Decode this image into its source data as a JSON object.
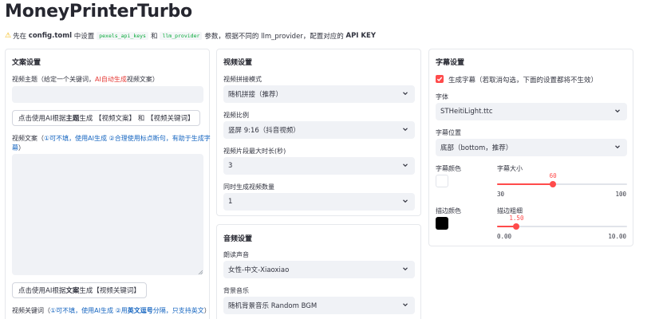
{
  "app": {
    "title": "MoneyPrinterTurbo"
  },
  "notice": {
    "prefix": "先在",
    "file": "config.toml",
    "middle1": "中设置",
    "key1": "pexels_api_keys",
    "and": "和",
    "key2": "llm_provider",
    "middle2": "参数，根据不同的 llm_provider，配置对应的",
    "suffix": "API KEY"
  },
  "script_panel": {
    "title": "文案设置",
    "subject_label_a": "视频主题（给定一个关键词，",
    "subject_label_red": "AI自动生成",
    "subject_label_b": "视频文案）",
    "subject_value": "",
    "gen_script_btn_a": "点击使用AI根据",
    "gen_script_btn_bold": "主题",
    "gen_script_btn_b": "生成 【视频文案】 和 【视频关键词】",
    "script_label_a": "视频文案（",
    "script_label_blue": "①可不填，使用AI生成 ②合理使用标点断句，有助于生成字",
    "script_label_blue2": "幕",
    "script_label_b": "）",
    "gen_keywords_btn_a": "点击使用AI根据",
    "gen_keywords_btn_bold": "文案",
    "gen_keywords_btn_b": "生成【视频关键词】",
    "keywords_label_a": "视频关键词（",
    "keywords_label_blue": "①可不填，使用AI生成 ②用",
    "keywords_label_bold": "英文逗号",
    "keywords_label_blue2": "分隔，只支持英文",
    "keywords_label_b": "）"
  },
  "video_panel": {
    "title": "视频设置",
    "concat_label": "视频拼接模式",
    "concat_value": "随机拼接（推荐）",
    "ratio_label": "视频比例",
    "ratio_value": "竖屏 9:16（抖音视频）",
    "clip_label": "视频片段最大时长(秒)",
    "clip_value": "3",
    "count_label": "同时生成视频数量",
    "count_value": "1"
  },
  "audio_panel": {
    "title": "音频设置",
    "voice_label": "朗读声音",
    "voice_value": "女性-中文-Xiaoxiao",
    "bgm_label": "背景音乐",
    "bgm_value": "随机背景音乐 Random BGM"
  },
  "subtitle_panel": {
    "title": "字幕设置",
    "enable_label": "生成字幕（若取消勾选，下面的设置都将不生效）",
    "font_label": "字体",
    "font_value": "STHeitiLight.ttc",
    "position_label": "字幕位置",
    "position_value": "底部（bottom，推荐）",
    "color_label": "字幕颜色",
    "color_value": "#ffffff",
    "size_label": "字幕大小",
    "size_value": "60",
    "size_min": "30",
    "size_max": "100",
    "size_fraction": 0.43,
    "stroke_color_label": "描边颜色",
    "stroke_color_value": "#000000",
    "stroke_width_label": "描边粗细",
    "stroke_width_value": "1.50",
    "stroke_min": "0.00",
    "stroke_max": "10.00",
    "stroke_fraction": 0.15
  },
  "colors": {
    "accent": "#ff4b4b",
    "input_bg": "#f0f2f6",
    "link_blue": "#1565c0",
    "red_text": "#e53935"
  }
}
